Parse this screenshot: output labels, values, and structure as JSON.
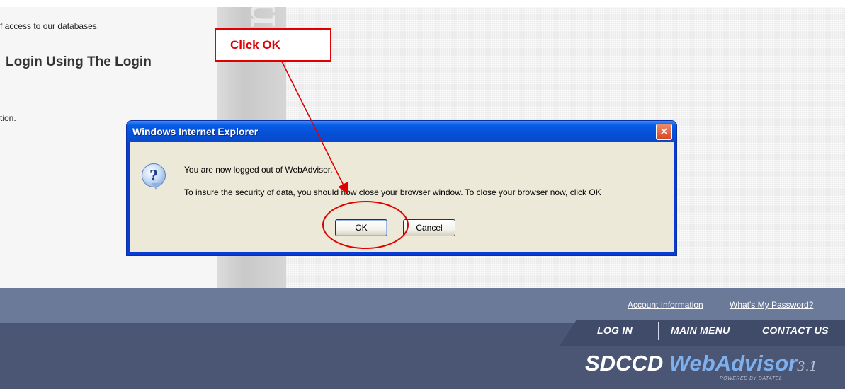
{
  "page": {
    "text_line1": "f access to our databases.",
    "heading": "Login Using The Login",
    "text_line2": "tion."
  },
  "dialog": {
    "title": "Windows Internet Explorer",
    "close_glyph": "✕",
    "icon": "question-icon",
    "icon_glyph": "?",
    "message_line1": "You are now logged out of WebAdvisor.",
    "message_line2": "To insure the security of data, you should now close your browser window.  To close your browser now, click OK",
    "ok_label": "OK",
    "cancel_label": "Cancel"
  },
  "callout": {
    "text": "Click OK",
    "color": "#e00000"
  },
  "footer": {
    "links": {
      "account": "Account Information",
      "password": "What's My Password?"
    },
    "nav": {
      "login": "LOG IN",
      "main_menu": "MAIN MENU",
      "contact": "CONTACT US"
    },
    "brand": {
      "name": "SDCCD",
      "product": "WebAdvisor",
      "version": "3.1",
      "powered_by": "POWERED BY DATATEL"
    }
  },
  "colors": {
    "titlebar": "#0450d6",
    "dialog_body": "#ece9d8",
    "footer_top": "#6b7a99",
    "footer_bottom": "#4b5674",
    "annotation_red": "#e00000"
  }
}
